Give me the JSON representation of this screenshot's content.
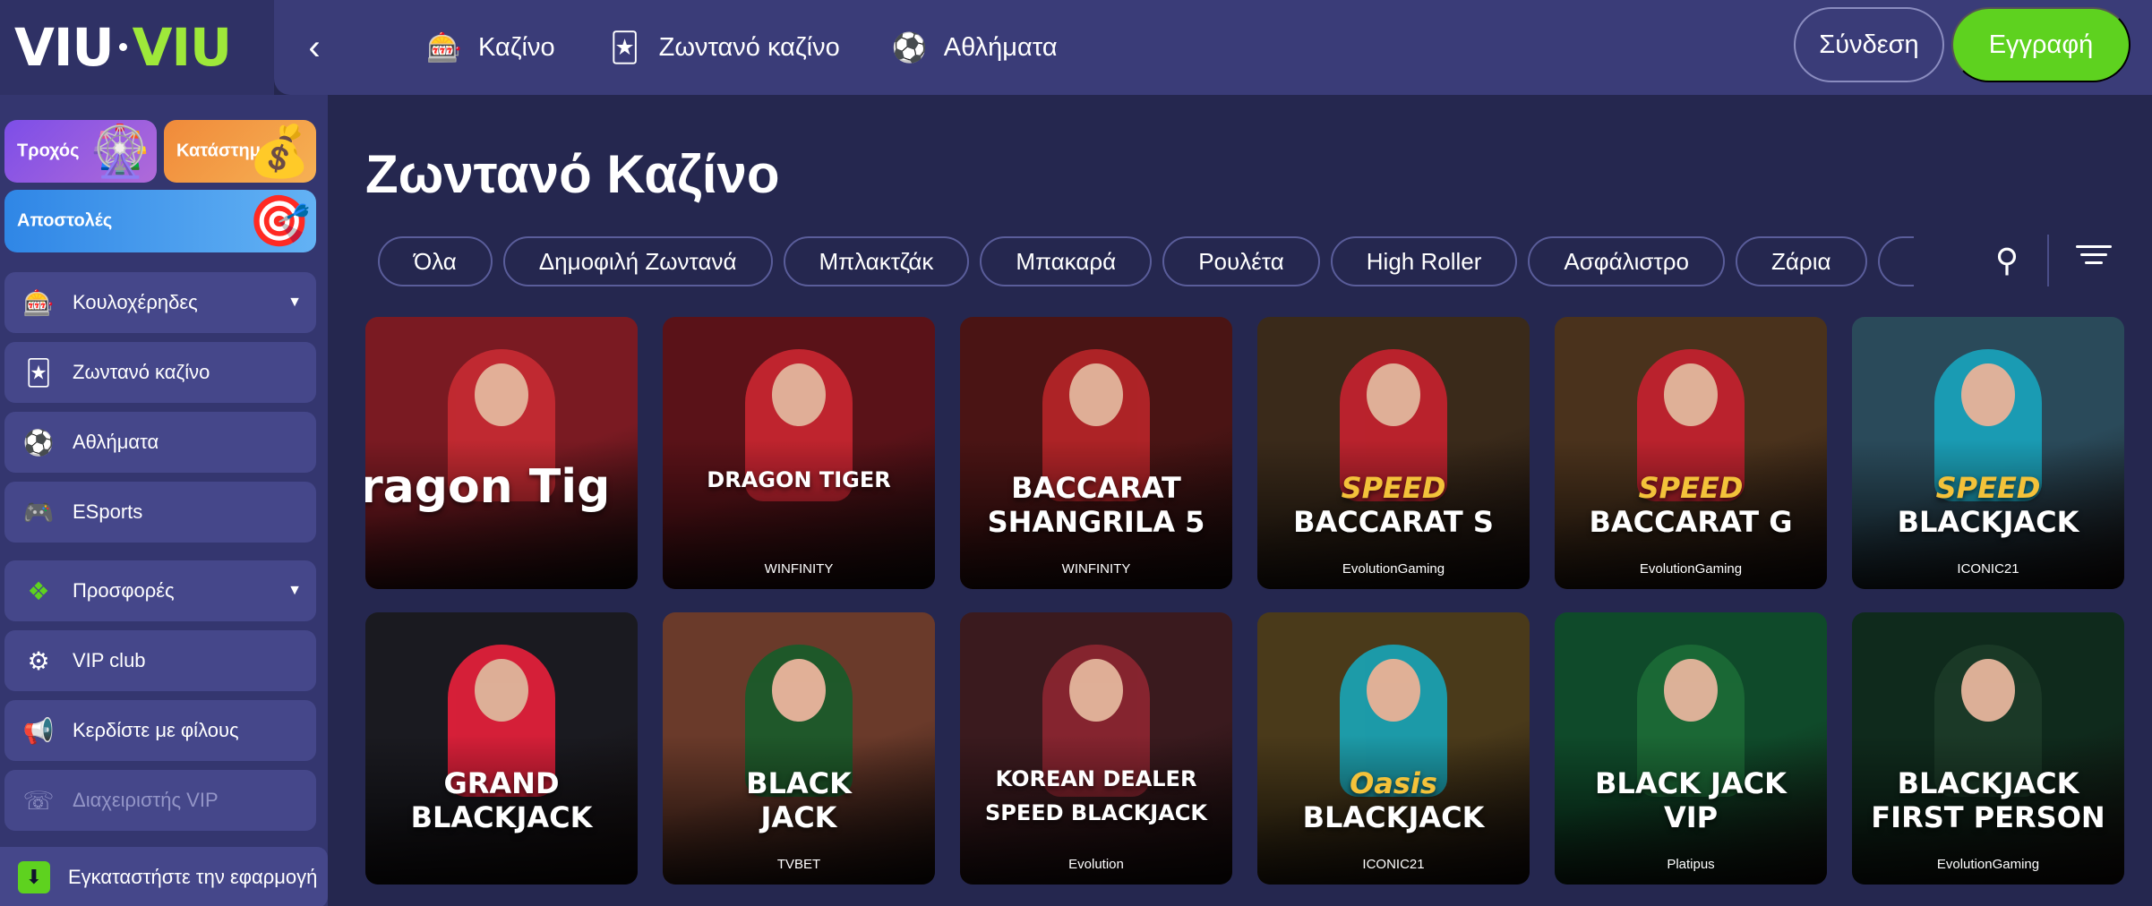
{
  "logo": {
    "part1": "VIU",
    "part2": "VIU"
  },
  "header": {
    "back_icon": "chevron-left-icon",
    "nav": [
      {
        "label": "Καζίνο",
        "icon": "slot-machine-icon"
      },
      {
        "label": "Ζωντανό καζίνο",
        "icon": "cards-icon"
      },
      {
        "label": "Αθλήματα",
        "icon": "football-icon"
      }
    ],
    "login_label": "Σύνδεση",
    "register_label": "Εγγραφή"
  },
  "sidebar": {
    "promos": [
      {
        "label": "Τροχός",
        "icon": "wheel-icon"
      },
      {
        "label": "Κατάστημα",
        "icon": "money-bag-icon"
      },
      {
        "label": "Αποστολές",
        "icon": "target-icon"
      }
    ],
    "items": [
      {
        "label": "Κουλοχέρηδες",
        "icon": "slots-icon",
        "has_caret": true
      },
      {
        "label": "Ζωντανό καζίνο",
        "icon": "cards-icon"
      },
      {
        "label": "Αθλήματα",
        "icon": "football-icon"
      },
      {
        "label": "ESports",
        "icon": "gamepad-icon"
      },
      {
        "label": "Προσφορές",
        "icon": "tag-icon",
        "has_caret": true
      },
      {
        "label": "VIP club",
        "icon": "vip-icon"
      },
      {
        "label": "Κερδίστε με φίλους",
        "icon": "megaphone-icon"
      },
      {
        "label": "Διαχειριστής VIP",
        "icon": "whatsapp-icon"
      },
      {
        "label": "Εγκαταστήστε την εφαρμογή",
        "icon": "download-icon"
      }
    ]
  },
  "main": {
    "title": "Ζωντανό Καζίνο",
    "filters": [
      "Όλα",
      "Δημοφιλή Ζωντανά",
      "Μπλακτζάκ",
      "Μπακαρά",
      "Ρουλέτα",
      "High Roller",
      "Ασφάλιστρο",
      "Ζάρια"
    ],
    "search_icon": "search-icon",
    "filter_icon": "filter-lines-icon",
    "games": [
      {
        "title": "ragon Tig",
        "subtitle": "",
        "provider": "",
        "bg": "#7a1a22",
        "accent": "#c42a32"
      },
      {
        "title": "DRAGON TIGER",
        "subtitle": "",
        "provider": "WINFINITY",
        "bg": "#5a1218",
        "accent": "#c52530"
      },
      {
        "title": "BACCARAT",
        "subtitle": "SHANGRILA 5",
        "provider": "WINFINITY",
        "bg": "#4a1414",
        "accent": "#b32428"
      },
      {
        "title": "SPEED",
        "subtitle": "BACCARAT S",
        "provider": "EvolutionGaming",
        "bg": "#3a2a1a",
        "accent": "#c0222e"
      },
      {
        "title": "SPEED",
        "subtitle": "BACCARAT G",
        "provider": "EvolutionGaming",
        "bg": "#4a321c",
        "accent": "#c0222e"
      },
      {
        "title": "SPEED",
        "subtitle": "BLACKJACK",
        "provider": "ICONIC21",
        "bg": "#2a4a5a",
        "accent": "#1aa0b8"
      },
      {
        "title": "GRAND",
        "subtitle": "BLACKJACK",
        "provider": "",
        "bg": "#1a1a20",
        "accent": "#e0203a"
      },
      {
        "title": "BLACK",
        "subtitle": "JACK",
        "provider": "TVBET",
        "bg": "#6a3a2a",
        "accent": "#1b5a2a"
      },
      {
        "title": "KOREAN DEALER",
        "subtitle": "SPEED BLACKJACK",
        "provider": "Evolution",
        "bg": "#3a1a1e",
        "accent": "#8a2530"
      },
      {
        "title": "Oasis",
        "subtitle": "BLACKJACK",
        "provider": "ICONIC21",
        "bg": "#4a3a1a",
        "accent": "#1aa0b0"
      },
      {
        "title": "BLACK JACK",
        "subtitle": "VIP",
        "provider": "Platipus",
        "bg": "#0f4a2a",
        "accent": "#1c6a36"
      },
      {
        "title": "BLACKJACK",
        "subtitle": "FIRST PERSON",
        "provider": "EvolutionGaming",
        "bg": "#0f2a1c",
        "accent": "#1c3a28"
      }
    ]
  },
  "colors": {
    "accent_green": "#5ed21f",
    "header_bg": "#3a3c78",
    "sidebar_bg": "#34366f",
    "page_bg": "#25274f"
  }
}
